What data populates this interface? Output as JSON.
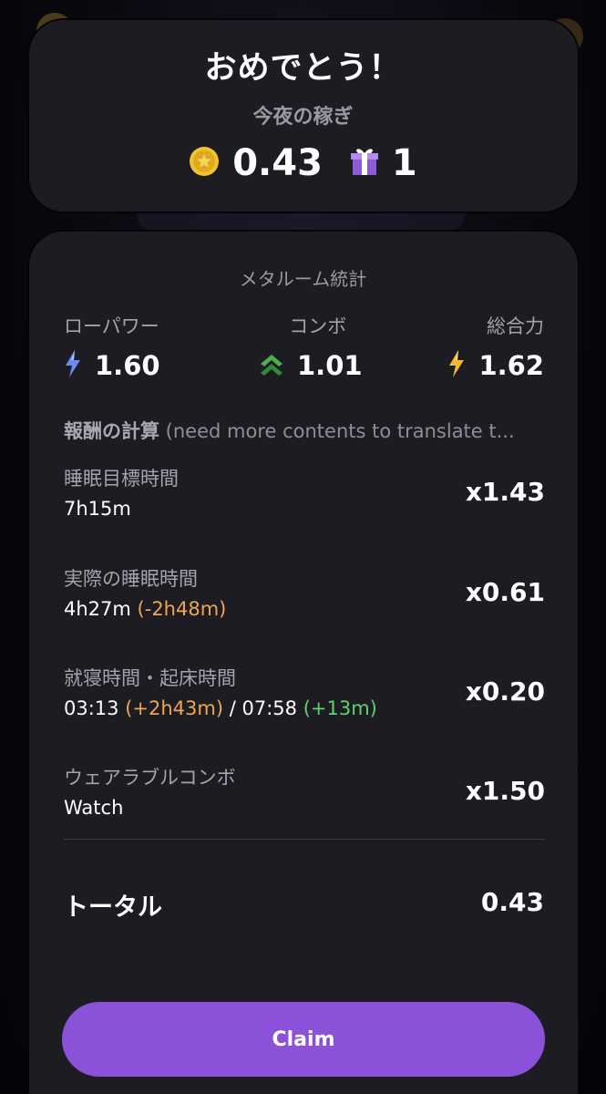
{
  "header": {
    "title": "おめでとう！",
    "subtitle": "今夜の稼ぎ",
    "coin_value": "0.43",
    "gift_value": "1",
    "coin_icon": "coin-icon",
    "gift_icon": "gift-icon"
  },
  "stats": {
    "section_title": "メタルーム統計",
    "items": [
      {
        "label": "ローパワー",
        "value": "1.60",
        "icon": "lightning-blue-icon"
      },
      {
        "label": "コンボ",
        "value": "1.01",
        "icon": "double-chevron-up-icon"
      },
      {
        "label": "総合力",
        "value": "1.62",
        "icon": "lightning-yellow-icon"
      }
    ]
  },
  "calc": {
    "title_bold": "報酬の計算",
    "title_rest": " (need more contents to translate t...",
    "rows": [
      {
        "label": "睡眠目標時間",
        "sub": "7h15m",
        "multiplier": "x1.43"
      },
      {
        "label": "実際の睡眠時間",
        "sub": "4h27m",
        "sub_diff": "(-2h48m)",
        "multiplier": "x0.61"
      },
      {
        "label": "就寝時間・起床時間",
        "sub": "03:13",
        "sub_diff": "(+2h43m)",
        "sub_sep": "/ 07:58",
        "sub_diff2": "(+13m)",
        "multiplier": "x0.20"
      },
      {
        "label": "ウェアラブルコンボ",
        "sub": "Watch",
        "multiplier": "x1.50"
      }
    ],
    "total_label": "トータル",
    "total_value": "0.43"
  },
  "claim_label": "Claim",
  "colors": {
    "accent": "#8b51d8",
    "card_bg": "#1d1c22",
    "orange": "#f0a64e",
    "green": "#5fd36a",
    "muted": "#a3a3ab"
  }
}
